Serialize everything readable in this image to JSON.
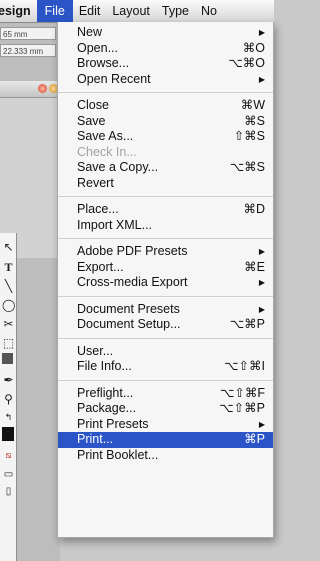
{
  "menubar": {
    "app_name": "esign",
    "items": [
      "File",
      "Edit",
      "Layout",
      "Type",
      "No"
    ]
  },
  "background": {
    "field1": "65 mm",
    "field2": "22.333 mm"
  },
  "file_menu": {
    "groups": [
      [
        {
          "label": "New",
          "shortcut": "▶"
        },
        {
          "label": "Open...",
          "shortcut": "⌘O"
        },
        {
          "label": "Browse...",
          "shortcut": "⌥⌘O"
        },
        {
          "label": "Open Recent",
          "shortcut": "▶"
        }
      ],
      [
        {
          "label": "Close",
          "shortcut": "⌘W"
        },
        {
          "label": "Save",
          "shortcut": "⌘S"
        },
        {
          "label": "Save As...",
          "shortcut": "⇧⌘S"
        },
        {
          "label": "Check In...",
          "shortcut": "",
          "disabled": true
        },
        {
          "label": "Save a Copy...",
          "shortcut": "⌥⌘S"
        },
        {
          "label": "Revert",
          "shortcut": ""
        }
      ],
      [
        {
          "label": "Place...",
          "shortcut": "⌘D"
        },
        {
          "label": "Import XML...",
          "shortcut": ""
        }
      ],
      [
        {
          "label": "Adobe PDF Presets",
          "shortcut": "▶"
        },
        {
          "label": "Export...",
          "shortcut": "⌘E"
        },
        {
          "label": "Cross-media Export",
          "shortcut": "▶"
        }
      ],
      [
        {
          "label": "Document Presets",
          "shortcut": "▶"
        },
        {
          "label": "Document Setup...",
          "shortcut": "⌥⌘P"
        }
      ],
      [
        {
          "label": "User...",
          "shortcut": ""
        },
        {
          "label": "File Info...",
          "shortcut": "⌥⇧⌘I"
        }
      ],
      [
        {
          "label": "Preflight...",
          "shortcut": "⌥⇧⌘F"
        },
        {
          "label": "Package...",
          "shortcut": "⌥⇧⌘P"
        },
        {
          "label": "Print Presets",
          "shortcut": "▶"
        },
        {
          "label": "Print...",
          "shortcut": "⌘P",
          "highlighted": true
        },
        {
          "label": "Print Booklet...",
          "shortcut": ""
        }
      ]
    ]
  },
  "colors": {
    "highlight": "#2b55c6",
    "menu_bg": "#f6f6f6",
    "disabled_text": "#a3a3a3"
  },
  "toolbox_icons": [
    "direct-select-icon",
    "type-icon",
    "line-icon",
    "ellipse-icon",
    "scissors-icon",
    "free-transform-icon",
    "gradient-icon",
    "eyedropper-icon",
    "zoom-icon",
    "swap-arrow-icon",
    "fill-stroke-icon",
    "default-colors-icon",
    "apply-color-icon",
    "view-mode-icon"
  ]
}
